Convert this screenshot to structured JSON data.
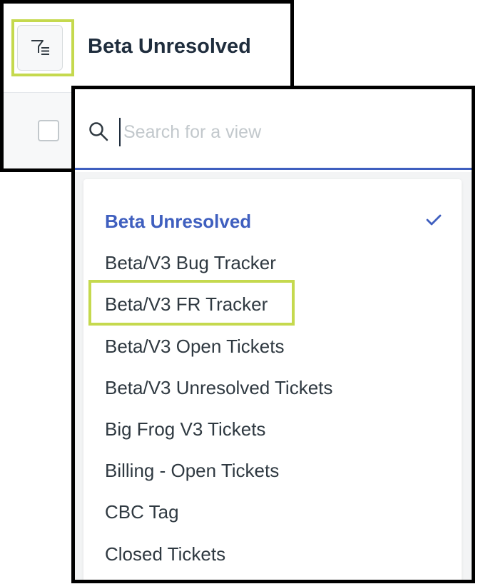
{
  "header": {
    "title": "Beta Unresolved",
    "filter_icon": "filter-list-icon"
  },
  "search": {
    "placeholder": "Search for a view",
    "value": "",
    "icon": "search-icon"
  },
  "views": {
    "items": [
      {
        "label": "Beta Unresolved",
        "selected": true
      },
      {
        "label": "Beta/V3 Bug Tracker"
      },
      {
        "label": "Beta/V3 FR Tracker"
      },
      {
        "label": "Beta/V3 Open Tickets"
      },
      {
        "label": "Beta/V3 Unresolved Tickets"
      },
      {
        "label": "Big Frog V3 Tickets"
      },
      {
        "label": "Billing - Open Tickets"
      },
      {
        "label": "CBC Tag"
      },
      {
        "label": "Closed Tickets"
      }
    ],
    "selected_icon": "checkmark-icon"
  },
  "colors": {
    "accent": "#3f5fbf",
    "highlight": "#c5d94e",
    "text": "#2f3941",
    "title": "#1f2d3d"
  }
}
